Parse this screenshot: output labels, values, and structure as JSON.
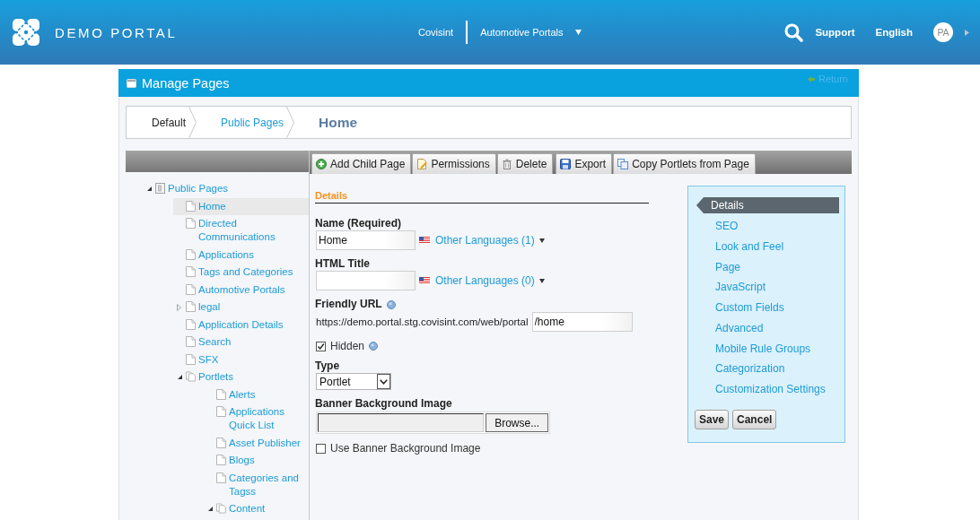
{
  "header": {
    "brand": "DEMO PORTAL",
    "site": "Covisint",
    "site_menu": "Automotive Portals",
    "links": [
      "Support",
      "English"
    ],
    "avatar": "PA"
  },
  "portlet": {
    "title": "Manage Pages",
    "return_link": "Return"
  },
  "breadcrumb": [
    {
      "label": "Default",
      "kind": "plain"
    },
    {
      "label": "Public Pages",
      "kind": "link"
    },
    {
      "label": "Home",
      "kind": "current"
    }
  ],
  "toolbar": [
    {
      "buttons": [
        {
          "label": "Add Child Page",
          "kind": "add"
        },
        {
          "label": "Permissions",
          "kind": "permissions"
        },
        {
          "label": "Delete",
          "kind": "delete"
        }
      ]
    },
    {
      "buttons": [
        {
          "label": "Export",
          "kind": "export"
        },
        {
          "label": "Copy Portlets from Page",
          "kind": "copy"
        }
      ]
    }
  ],
  "tree": [
    {
      "label": "Public Pages",
      "kind": "root",
      "expanded": true,
      "selected": false,
      "children": [
        {
          "label": "Home",
          "kind": "page",
          "selected": true
        },
        {
          "label": "Directed Communications",
          "kind": "page",
          "selected": false
        },
        {
          "label": "Applications",
          "kind": "page",
          "selected": false
        },
        {
          "label": "Tags and Categories",
          "kind": "page",
          "selected": false
        },
        {
          "label": "Automotive Portals",
          "kind": "page",
          "selected": false
        },
        {
          "label": "legal",
          "kind": "page",
          "expanded": false,
          "selected": false
        },
        {
          "label": "Application Details",
          "kind": "page",
          "selected": false
        },
        {
          "label": "Search",
          "kind": "page",
          "selected": false
        },
        {
          "label": "SFX",
          "kind": "page",
          "selected": false
        },
        {
          "label": "Portlets",
          "kind": "stack",
          "expanded": true,
          "selected": false,
          "children": [
            {
              "label": "Alerts",
              "kind": "page",
              "selected": false
            },
            {
              "label": "Applications Quick List",
              "kind": "page",
              "selected": false
            },
            {
              "label": "Asset Publisher",
              "kind": "page",
              "selected": false
            },
            {
              "label": "Blogs",
              "kind": "page",
              "selected": false
            },
            {
              "label": "Categories and Tagss",
              "kind": "page",
              "selected": false
            },
            {
              "label": "Content",
              "kind": "stack",
              "expanded": true,
              "selected": false
            }
          ]
        }
      ]
    }
  ],
  "form": {
    "section": "Details",
    "fields": [
      {
        "kind": "localized",
        "label": "Name (Required)",
        "value": "Home",
        "languages_link": "Other Languages (1)"
      },
      {
        "kind": "localized",
        "label": "HTML Title",
        "languages_link": "Other Languages (0)"
      },
      {
        "kind": "url",
        "label": "Friendly URL",
        "prefix": "https://demo.portal.stg.covisint.com/web/portal",
        "value": "/home",
        "help": true
      },
      {
        "kind": "checkbox",
        "label": "Hidden",
        "checked": true,
        "help": true
      },
      {
        "kind": "select",
        "label": "Type",
        "value": "Portlet"
      },
      {
        "kind": "file",
        "label": "Banner Background Image",
        "button": "Browse..."
      },
      {
        "kind": "checkbox",
        "label": "Use Banner Background Image",
        "checked": false
      }
    ]
  },
  "side_nav": {
    "items": [
      {
        "label": "Details",
        "selected": true
      },
      {
        "label": "SEO",
        "selected": false
      },
      {
        "label": "Look and Feel",
        "selected": false
      },
      {
        "label": "Page",
        "selected": false
      },
      {
        "label": "JavaScript",
        "selected": false
      },
      {
        "label": "Custom Fields",
        "selected": false
      },
      {
        "label": "Advanced",
        "selected": false
      },
      {
        "label": "Mobile Rule Groups",
        "selected": false
      },
      {
        "label": "Categorization",
        "selected": false
      },
      {
        "label": "Customization Settings",
        "selected": false
      }
    ],
    "buttons": [
      "Save",
      "Cancel"
    ]
  }
}
